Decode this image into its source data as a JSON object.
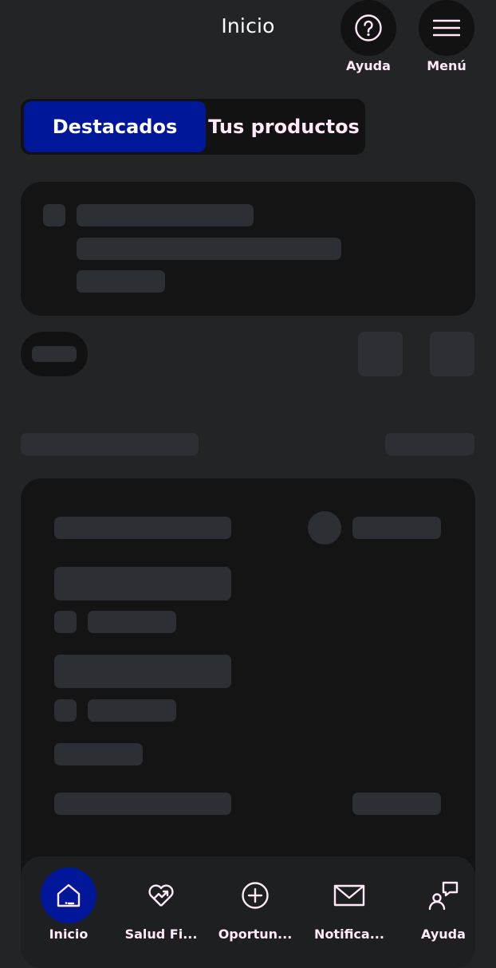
{
  "header": {
    "title": "Inicio",
    "help_label": "Ayuda",
    "menu_label": "Menú"
  },
  "segmented": {
    "options": [
      "Destacados",
      "Tus productos"
    ],
    "selected": "Destacados"
  },
  "bottom_nav": {
    "items": [
      {
        "label": "Inicio",
        "icon": "home-icon",
        "active": true
      },
      {
        "label": "Salud Fi...",
        "icon": "heart-chart-icon",
        "active": false
      },
      {
        "label": "Oportun...",
        "icon": "plus-circle-icon",
        "active": false
      },
      {
        "label": "Notifica...",
        "icon": "mail-icon",
        "active": false
      },
      {
        "label": "Ayuda",
        "icon": "support-chat-icon",
        "active": false
      }
    ]
  },
  "colors": {
    "background": "#222425",
    "card": "#141414",
    "skeleton": "#2c2f33",
    "accent": "#00179a",
    "label_tint": "#ffe9fb"
  }
}
